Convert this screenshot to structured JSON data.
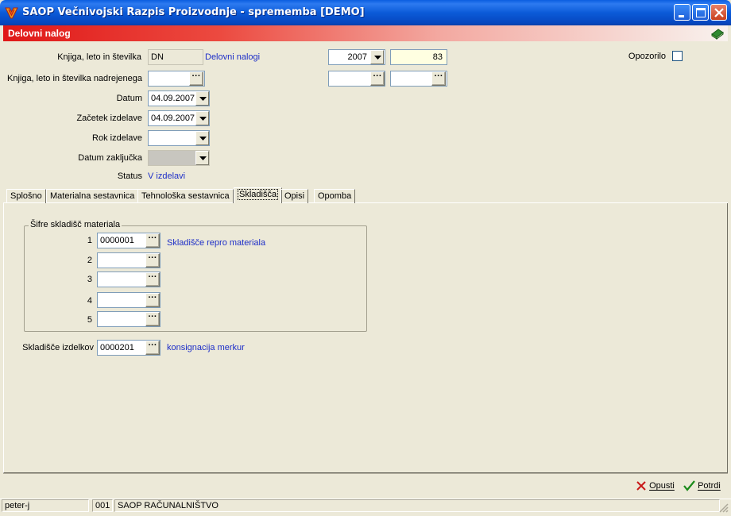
{
  "window": {
    "title": "SAOP  Večnivojski Razpis Proizvodnje  - sprememba [DEMO]"
  },
  "form": {
    "title": "Delovni nalog"
  },
  "fields": {
    "knjiga_label": "Knjiga, leto in številka",
    "knjiga_code": "DN",
    "knjiga_name": "Delovni nalogi",
    "leto": "2007",
    "stevilka": "83",
    "nadrejenega_label": "Knjiga, leto in številka nadrejenega",
    "nadrejenega_knjiga": "",
    "nadrejenega_leto": "",
    "nadrejenega_stevilka": "",
    "datum_label": "Datum",
    "datum": "04.09.2007",
    "zacetek_label": "Začetek izdelave",
    "zacetek": "04.09.2007",
    "rok_label": "Rok izdelave",
    "rok": "",
    "zakljucek_label": "Datum zaključka",
    "zakljucek": "",
    "status_label": "Status",
    "status": "V izdelavi",
    "opozorilo_label": "Opozorilo",
    "opozorilo_checked": false
  },
  "tabs": [
    {
      "label": "Splošno"
    },
    {
      "label": "Materialna sestavnica"
    },
    {
      "label": "Tehnološka sestavnica"
    },
    {
      "label": "Skladišča",
      "active": true
    },
    {
      "label": "Opisi"
    },
    {
      "label": "Opomba"
    }
  ],
  "skladisca": {
    "group_title": "Šifre skladišč materiala",
    "rows": [
      {
        "num": "1",
        "code": "0000001",
        "name": "Skladišče repro materiala"
      },
      {
        "num": "2",
        "code": "",
        "name": ""
      },
      {
        "num": "3",
        "code": "",
        "name": ""
      },
      {
        "num": "4",
        "code": "",
        "name": ""
      },
      {
        "num": "5",
        "code": "",
        "name": ""
      }
    ],
    "izdelkov_label": "Skladišče izdelkov",
    "izdelkov_code": "0000201",
    "izdelkov_name": "konsignacija merkur"
  },
  "buttons": {
    "cancel": "Opusti",
    "confirm": "Potrdi"
  },
  "statusbar": {
    "user": "peter-j",
    "company_code": "001",
    "company_name": "SAOP RAČUNALNIŠTVO"
  },
  "colors": {
    "titlebar": "#0a5ee0",
    "form_header": "#e01818",
    "link_blue": "#1d2ec8"
  },
  "icons": [
    "app-icon",
    "minimize-icon",
    "maximize-icon",
    "close-icon",
    "book-icon",
    "ellipsis-icon",
    "dropdown-arrow-icon",
    "x-icon",
    "checkmark-icon",
    "resize-grip-icon"
  ]
}
